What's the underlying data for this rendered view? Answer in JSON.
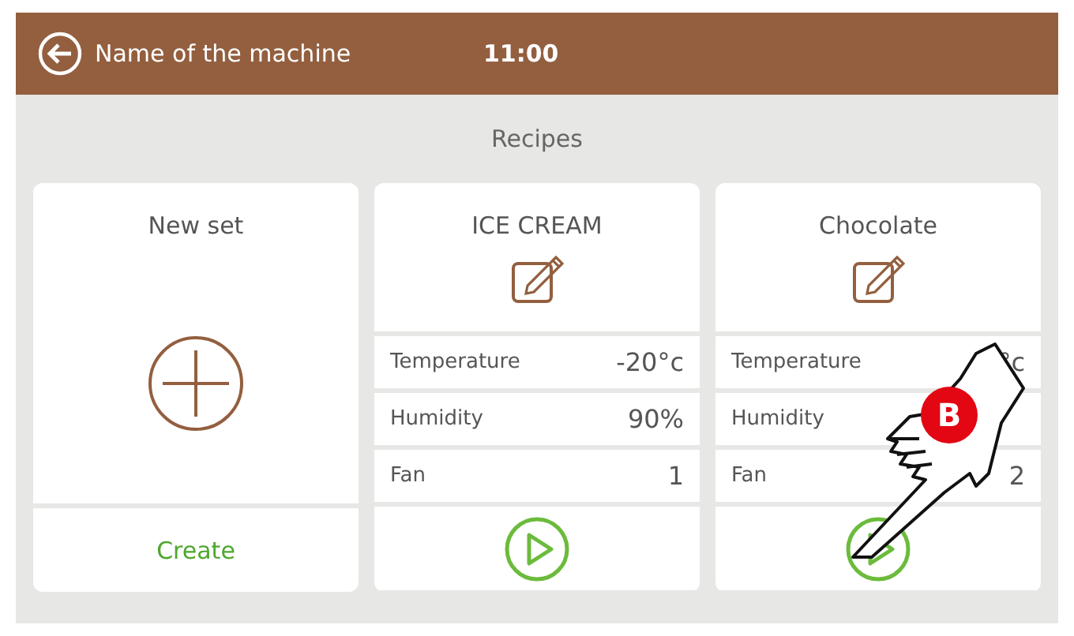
{
  "header": {
    "title": "Name of the machine",
    "time": "11:00"
  },
  "section_title": "Recipes",
  "cards": [
    {
      "kind": "new",
      "title": "New set",
      "action": "Create"
    },
    {
      "kind": "recipe",
      "title": "ICE CREAM",
      "params": [
        {
          "label": "Temperature",
          "value": "-20°c"
        },
        {
          "label": "Humidity",
          "value": "90%"
        },
        {
          "label": "Fan",
          "value": "1"
        }
      ]
    },
    {
      "kind": "recipe",
      "title": "Chocolate",
      "params": [
        {
          "label": "Temperature",
          "value": "°c"
        },
        {
          "label": "Humidity"
        },
        {
          "label": "Fan",
          "value": "2"
        }
      ]
    }
  ],
  "pointer": {
    "badge": "B"
  }
}
